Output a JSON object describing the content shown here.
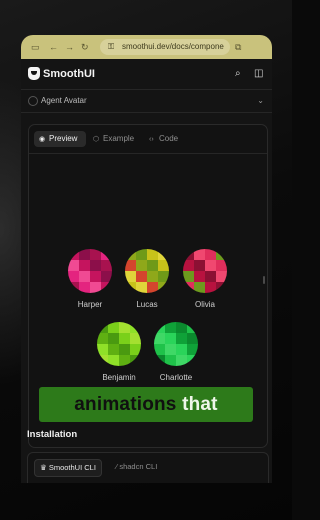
{
  "browser": {
    "url": "smoothui.dev/docs/compone",
    "icons": [
      "sidebar-toggle-icon",
      "back-icon",
      "forward-icon",
      "reload-icon",
      "lock-icon",
      "tab-icon"
    ]
  },
  "header": {
    "brand": "SmoothUI",
    "icons": [
      "smoothui-logo-icon",
      "search-icon",
      "sidebar-panel-icon"
    ]
  },
  "selector": {
    "label": "Agent Avatar"
  },
  "preview": {
    "tabs": [
      {
        "label": "Preview",
        "icon": "eye-icon",
        "active": true
      },
      {
        "label": "Example",
        "icon": "cube-icon",
        "active": false
      },
      {
        "label": "Code",
        "icon": "code-icon",
        "active": false
      }
    ],
    "avatars": [
      {
        "name": "Harper",
        "palette": [
          "#c5145e",
          "#e4247f",
          "#8c0f4a",
          "#f04a93",
          "#a8124f"
        ]
      },
      {
        "name": "Lucas",
        "palette": [
          "#c8c21a",
          "#8fa81a",
          "#e0d53a",
          "#6f9a18",
          "#d4452d"
        ]
      },
      {
        "name": "Olivia",
        "palette": [
          "#b8123f",
          "#e02e5c",
          "#8c1033",
          "#6e9a1e",
          "#f04870"
        ]
      },
      {
        "name": "Benjamin",
        "palette": [
          "#7ad01a",
          "#5fb012",
          "#a4e030",
          "#4a9a10",
          "#8fe028"
        ]
      },
      {
        "name": "Charlotte",
        "palette": [
          "#1fc24a",
          "#0fa238",
          "#3fd866",
          "#0b8a2e",
          "#2ad45a"
        ]
      }
    ]
  },
  "banner": {
    "word1": "animations",
    "word2": "that"
  },
  "installation": {
    "title": "Installation",
    "tabs": [
      {
        "label": "SmoothUI CLI",
        "icon": "smoothui-logo-icon",
        "active": true
      },
      {
        "label": "shadcn CLI",
        "icon": "slash-icon",
        "active": false
      }
    ]
  },
  "colors": {
    "url_bar": "#c9c27c",
    "banner_bg": "#2d7a1a",
    "surface": "#141414"
  }
}
